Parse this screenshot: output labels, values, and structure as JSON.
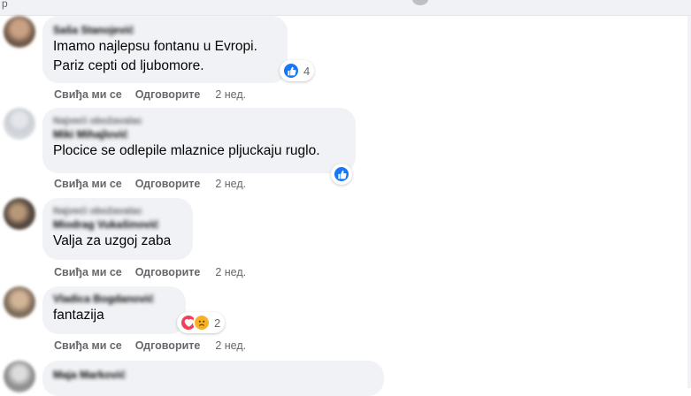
{
  "actions": {
    "like": "Свиђа ми се",
    "reply": "Одговорите"
  },
  "colors": {
    "bubble": "#f0f2f5",
    "like_blue": "#1877f2",
    "love_red": "#f33e58",
    "sad_yellow": "#f7b125",
    "secondary_text": "#65676b"
  },
  "comments": [
    {
      "author": "Saša Stanojević",
      "text_lines": [
        "Imamo najlepsu fontanu u Evropi.",
        "Pariz cepti od ljubomore."
      ],
      "time": "2 нед.",
      "reactions": {
        "icons": [
          "like-icon"
        ],
        "count": "4"
      }
    },
    {
      "meta": "Najveći obožavalac",
      "author": "Miki Mihajlović",
      "text_lines": [
        "Plocice se odlepile mlaznice pljuckaju ruglo."
      ],
      "time": "2 нед.",
      "reactions": {
        "icons": [
          "like-icon"
        ],
        "count": ""
      }
    },
    {
      "meta": "Najveći obožavalac",
      "author": "Miodrag Vukašinović",
      "text_lines": [
        "Valja za uzgoj zaba"
      ],
      "time": "2 нед."
    },
    {
      "author": "Vladica Bogdanović",
      "text_lines": [
        "fantazija"
      ],
      "time": "2 нед.",
      "reactions": {
        "icons": [
          "love-icon",
          "sad-icon"
        ],
        "count": "2"
      }
    },
    {
      "author": "Maja Marković",
      "text_lines": [
        ""
      ]
    }
  ]
}
